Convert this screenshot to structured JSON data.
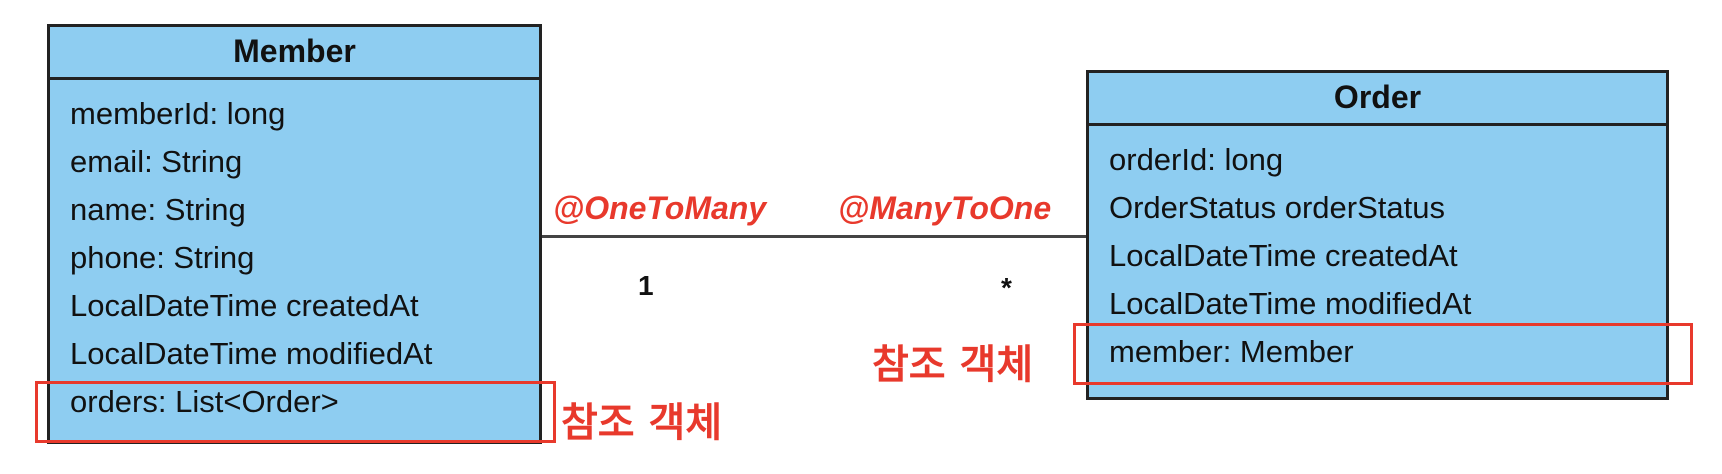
{
  "member": {
    "title": "Member",
    "attributes": [
      "memberId: long",
      "email: String",
      "name: String",
      "phone: String",
      "LocalDateTime createdAt",
      "LocalDateTime modifiedAt",
      "orders: List<Order>"
    ]
  },
  "order": {
    "title": "Order",
    "attributes": [
      "orderId: long",
      "OrderStatus orderStatus",
      "LocalDateTime createdAt",
      "LocalDateTime modifiedAt",
      "member: Member"
    ]
  },
  "association": {
    "member_side_annotation": "@OneToMany",
    "order_side_annotation": "@ManyToOne",
    "member_multiplicity": "1",
    "order_multiplicity": "*"
  },
  "callouts": {
    "member_ref_label": "참조 객체",
    "order_ref_label": "참조 객체"
  },
  "colors": {
    "class_fill": "#8ecdf1",
    "class_border": "#222222",
    "annotation_red": "#e8392c"
  }
}
